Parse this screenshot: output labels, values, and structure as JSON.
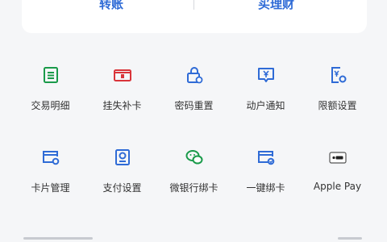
{
  "top_card": {
    "transfer_label": "转账",
    "wealth_label": "买理财"
  },
  "services": [
    {
      "label": "交易明细",
      "icon": "ledger-icon",
      "color": "#1a9a4a"
    },
    {
      "label": "挂失补卡",
      "icon": "card-lock-icon",
      "color": "#d9343a"
    },
    {
      "label": "密码重置",
      "icon": "lock-reset-icon",
      "color": "#2f6bd6"
    },
    {
      "label": "动户通知",
      "icon": "yuan-notice-icon",
      "color": "#2f6bd6"
    },
    {
      "label": "限额设置",
      "icon": "yuan-settings-icon",
      "color": "#2f6bd6"
    },
    {
      "label": "卡片管理",
      "icon": "card-settings-icon",
      "color": "#2f6bd6"
    },
    {
      "label": "支付设置",
      "icon": "payment-settings-icon",
      "color": "#2f6bd6"
    },
    {
      "label": "微银行绑卡",
      "icon": "wechat-bind-icon",
      "color": "#1a9a4a"
    },
    {
      "label": "一键绑卡",
      "icon": "quick-bind-icon",
      "color": "#2f6bd6"
    },
    {
      "label": "Apple Pay",
      "icon": "apple-pay-icon",
      "color": "#333333"
    }
  ]
}
